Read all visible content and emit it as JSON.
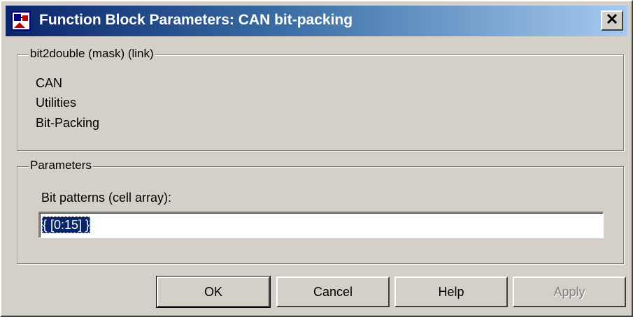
{
  "window": {
    "title": "Function Block Parameters: CAN bit-packing",
    "app_icon": "simulink-block-icon",
    "close_icon": "close-x-icon"
  },
  "mask_group": {
    "label": "bit2double (mask) (link)",
    "description_lines": [
      "CAN",
      "Utilities",
      "Bit-Packing"
    ]
  },
  "parameters_group": {
    "label": "Parameters",
    "bit_patterns": {
      "label": "Bit patterns (cell array):",
      "value": "{ [0:15] }"
    }
  },
  "buttons": {
    "ok": "OK",
    "cancel": "Cancel",
    "help": "Help",
    "apply": "Apply"
  },
  "colors": {
    "title_start": "#0a246a",
    "title_end": "#a6caf0",
    "face": "#d4d0c8",
    "selection": "#0a246a"
  }
}
